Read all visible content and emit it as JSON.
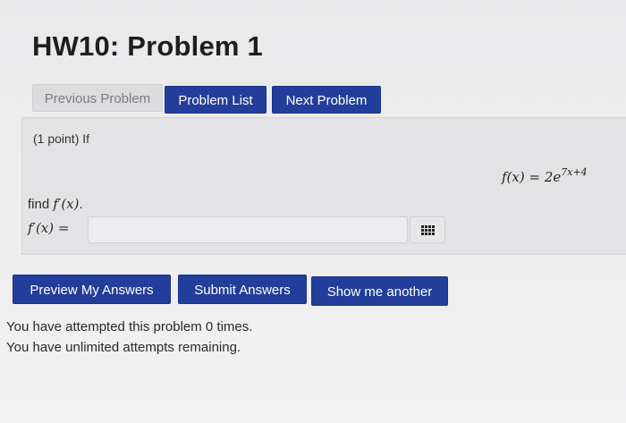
{
  "header": {
    "title": "HW10: Problem 1"
  },
  "nav": {
    "previous_label": "Previous Problem",
    "problem_list_label": "Problem List",
    "next_label": "Next Problem"
  },
  "problem": {
    "points_text": "(1 point) If",
    "formula_lhs": "f(x) = 2e",
    "formula_exponent": "7x+4",
    "find_prefix": "find ",
    "find_math": "f′(x)",
    "find_suffix": ".",
    "answer_label": "f′(x) =",
    "answer_value": "",
    "keypad_icon": "equation-keypad-icon"
  },
  "actions": {
    "preview_label": "Preview My Answers",
    "submit_label": "Submit Answers",
    "another_label": "Show me another"
  },
  "status": {
    "attempts_text": "You have attempted this problem 0 times.",
    "remaining_text": "You have unlimited attempts remaining."
  },
  "colors": {
    "primary_button": "#233e9a",
    "disabled_button": "#dcdcdf"
  }
}
